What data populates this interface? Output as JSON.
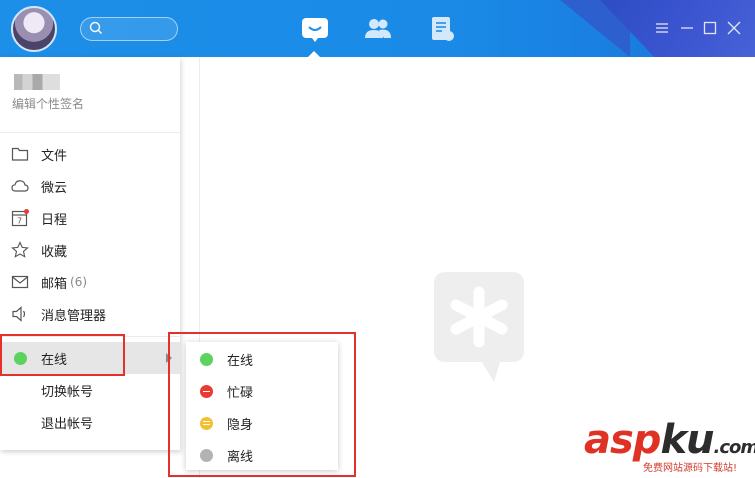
{
  "sidebar": {
    "signature": "编辑个性签名",
    "items": [
      {
        "label": "文件",
        "icon": "folder-icon"
      },
      {
        "label": "微云",
        "icon": "cloud-icon"
      },
      {
        "label": "日程",
        "icon": "calendar-icon",
        "calendar_day": "7"
      },
      {
        "label": "收藏",
        "icon": "star-icon"
      },
      {
        "label": "邮箱",
        "icon": "mail-icon",
        "count": "(6)"
      },
      {
        "label": "消息管理器",
        "icon": "speaker-icon"
      }
    ],
    "current_status": {
      "label": "在线",
      "color": "#5cd35f"
    },
    "switch_account": "切换帐号",
    "logout": "退出帐号"
  },
  "status_menu": {
    "options": [
      {
        "label": "在线",
        "color": "#5cd35f"
      },
      {
        "label": "忙碌",
        "color": "#ea3a31"
      },
      {
        "label": "隐身",
        "color": "#f4c032"
      },
      {
        "label": "离线",
        "color": "#b3b3b3"
      }
    ]
  },
  "watermark": {
    "brand_part1": "asp",
    "brand_part2": "ku",
    "brand_part3": ".com",
    "caption": "免费网站源码下载站!"
  },
  "colors": {
    "titlebar": "#1c8fe8",
    "highlight": "#e2322b"
  }
}
